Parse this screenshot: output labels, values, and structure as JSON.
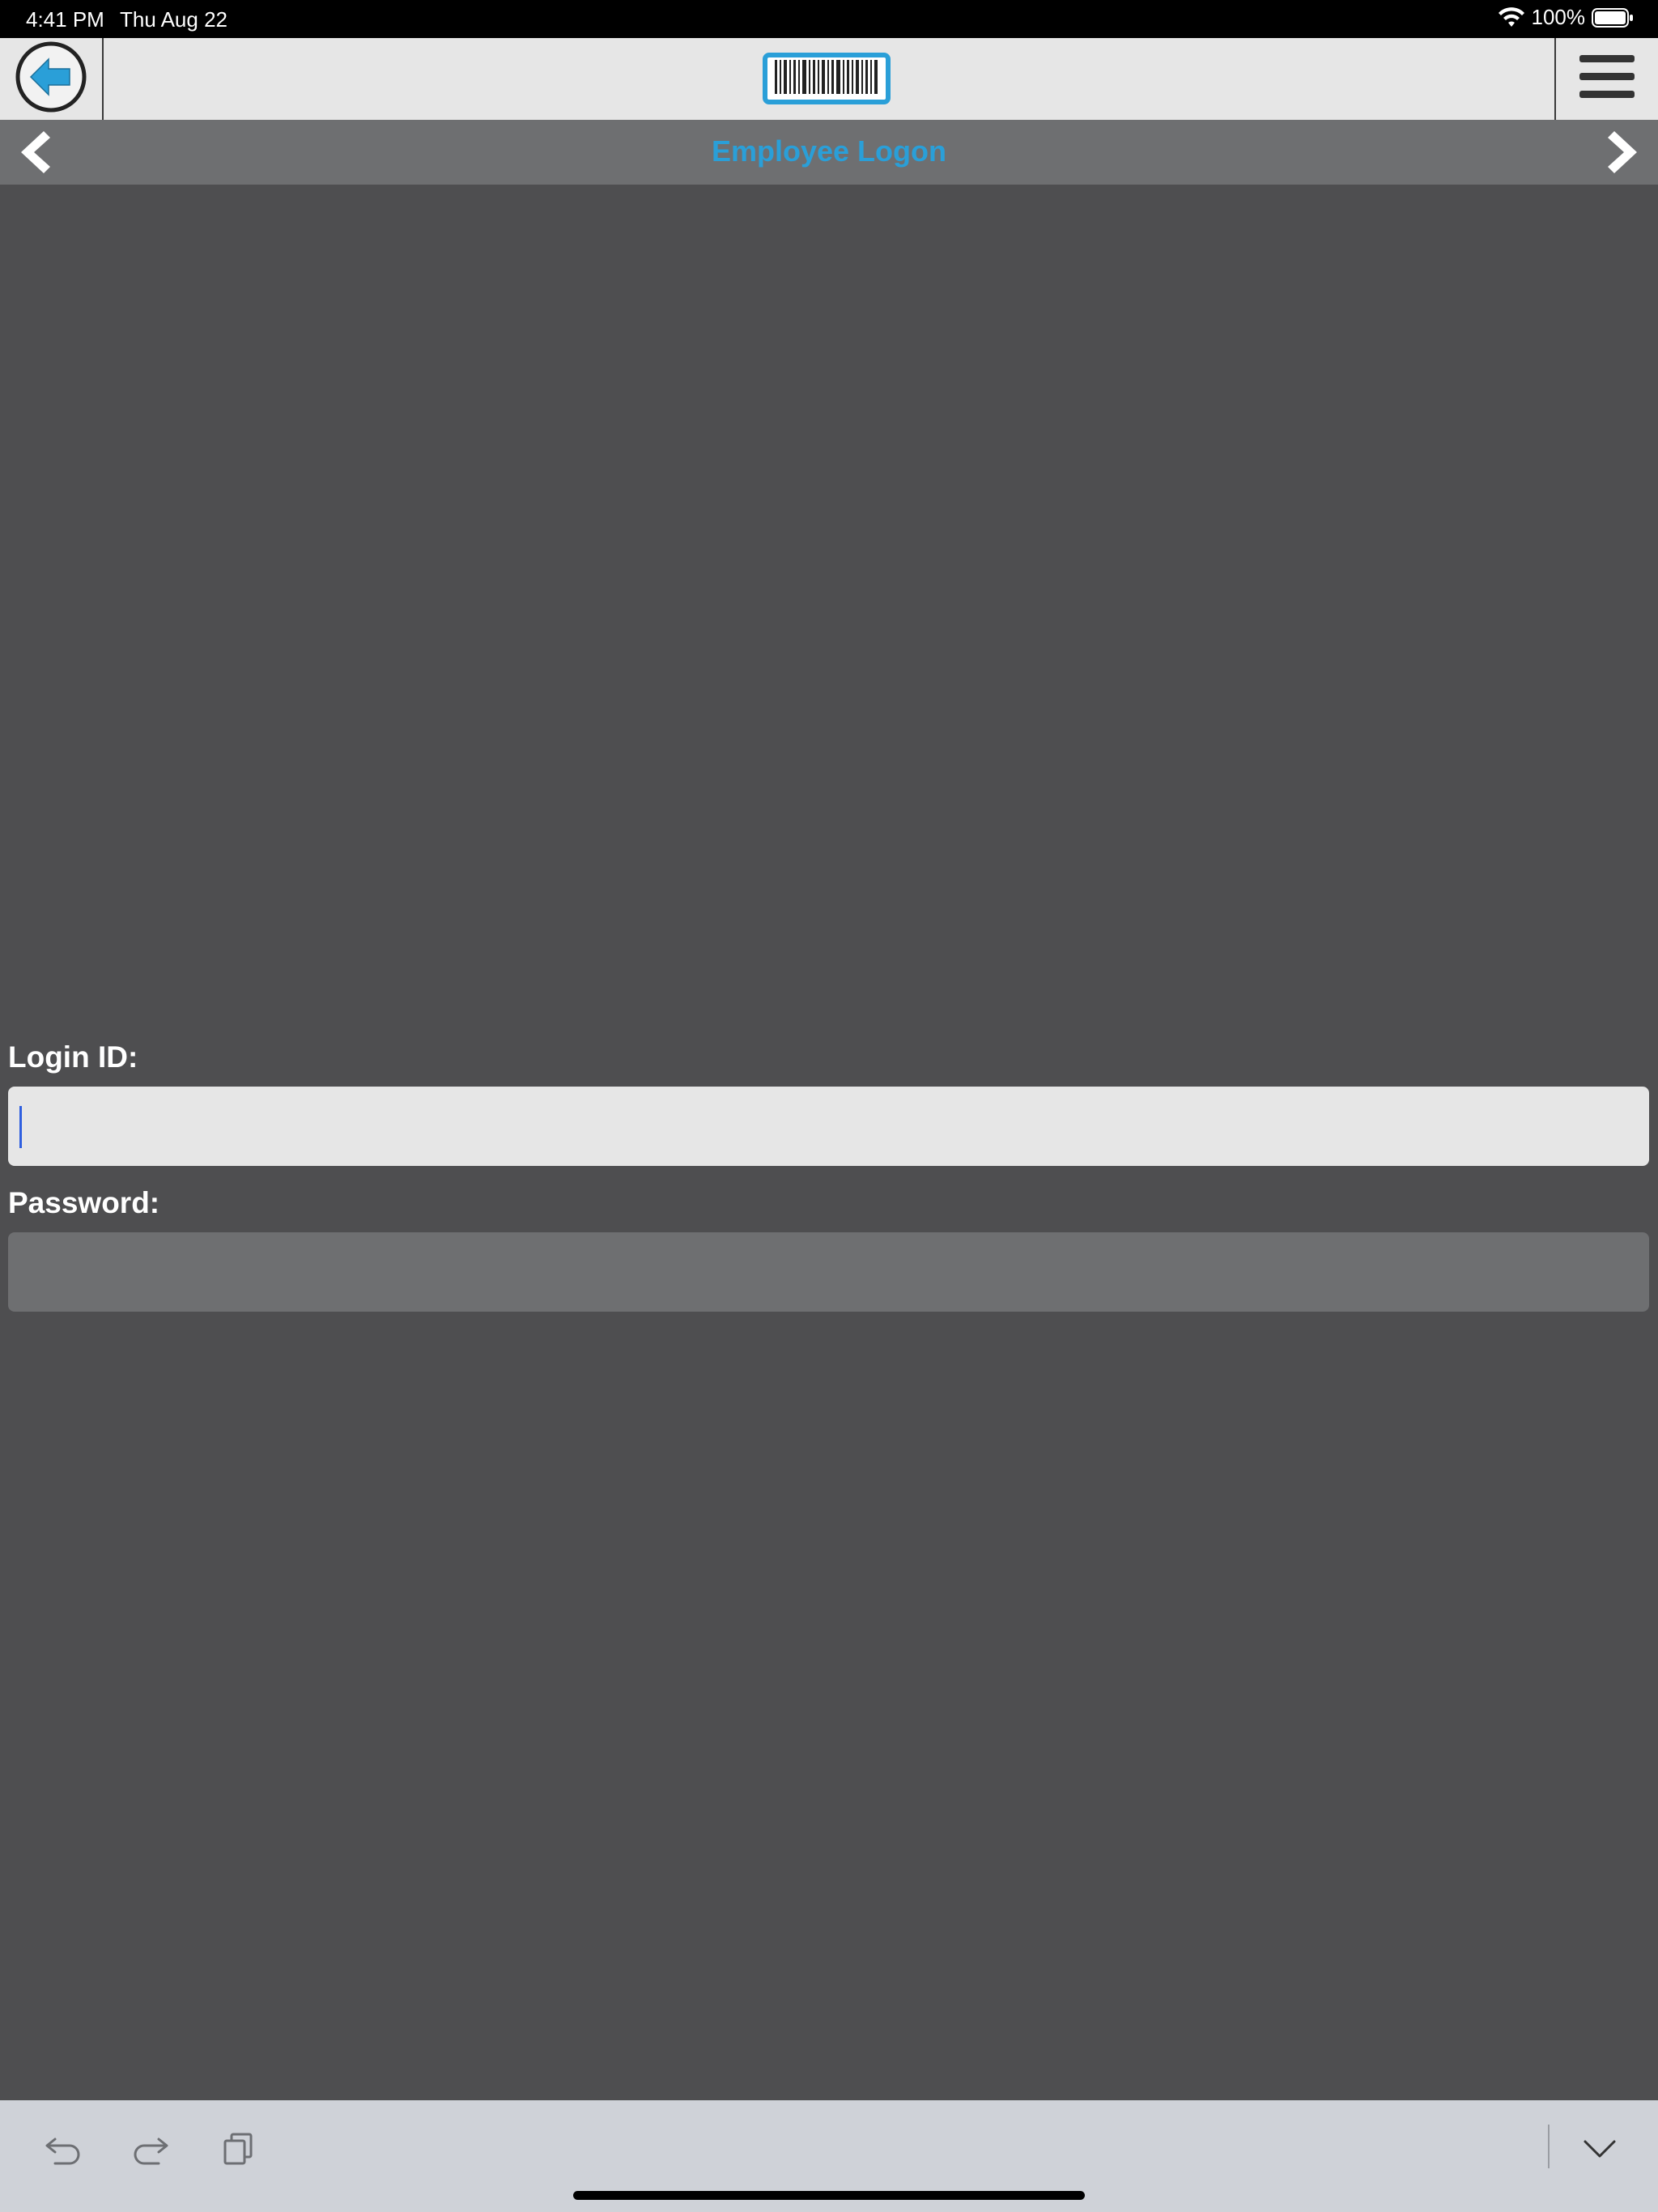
{
  "status_bar": {
    "time": "4:41 PM",
    "date": "Thu Aug 22",
    "battery": "100%"
  },
  "toolbar": {
    "back_icon": "arrow-left-circle-icon",
    "scan_icon": "barcode-icon",
    "menu_icon": "hamburger-menu-icon"
  },
  "title_bar": {
    "title": "Employee Logon",
    "prev_icon": "chevron-left-icon",
    "next_icon": "chevron-right-icon"
  },
  "form": {
    "login_label": "Login ID:",
    "login_value": "",
    "password_label": "Password:",
    "password_value": ""
  },
  "keyboard_bar": {
    "undo_icon": "undo-icon",
    "redo_icon": "redo-icon",
    "paste_icon": "paste-icon",
    "dismiss_icon": "chevron-down-icon"
  },
  "colors": {
    "accent": "#2a9fd8",
    "background": "#4e4e50",
    "title_bar": "#6e6f71",
    "toolbar": "#e6e6e6"
  }
}
